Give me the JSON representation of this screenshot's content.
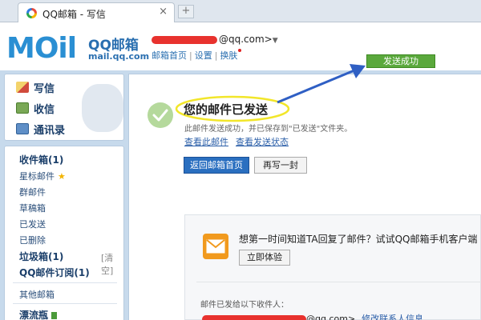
{
  "browser": {
    "tab_title": "QQ邮箱 - 写信",
    "tab_close": "×",
    "new_tab": "+"
  },
  "header": {
    "logo_word": "MOil",
    "logo_name": "QQ邮箱",
    "logo_url": "mail.qq.com",
    "user_email_visible": "@qq.com>",
    "user_menu_arrow": "▼",
    "links": [
      "邮箱首页",
      "设置",
      "换肤"
    ],
    "link_sep": "|",
    "success_badge": "发送成功"
  },
  "sidebar": {
    "actions": [
      {
        "label": "写信",
        "icon": "pen-paper-icon"
      },
      {
        "label": "收信",
        "icon": "inbox-download-icon"
      },
      {
        "label": "通讯录",
        "icon": "contacts-book-icon"
      }
    ],
    "folders": [
      {
        "label": "收件箱(1)",
        "bold": true
      },
      {
        "label": "星标邮件",
        "bold": false,
        "star": "★"
      },
      {
        "label": "群邮件",
        "bold": false
      },
      {
        "label": "草稿箱",
        "bold": false
      },
      {
        "label": "已发送",
        "bold": false
      },
      {
        "label": "已删除",
        "bold": false
      },
      {
        "label": "垃圾箱(1)",
        "bold": true
      },
      {
        "label": "QQ邮件订阅(1)",
        "bold": true
      },
      {
        "label": "其他邮箱",
        "bold": false
      },
      {
        "label": "漂流瓶",
        "bold": true
      }
    ],
    "trash_clear": "[清空]"
  },
  "main": {
    "title": "您的邮件已发送",
    "subtitle": "此邮件发送成功，并已保存到\"已发送\"文件夹。",
    "links": [
      "查看此邮件",
      "查看发送状态"
    ],
    "buttons": {
      "back": "返回邮箱首页",
      "rewrite": "再写一封"
    },
    "promo": {
      "text": "想第一时间知道TA回复了邮件？试试QQ邮箱手机客户端",
      "button": "立即体验"
    },
    "recipients_title": "邮件已发给以下收件人：",
    "recipient_email_visible": "@qq.com>",
    "recipient_edit": "修改联系人信息"
  },
  "colors": {
    "brand_blue": "#2a8fd3",
    "success_green": "#5aa83c",
    "primary_button": "#2a6fc0",
    "annotation_arrow": "#2f5fc4",
    "annotation_ellipse": "#f2e62a",
    "redaction": "#e8322e"
  }
}
